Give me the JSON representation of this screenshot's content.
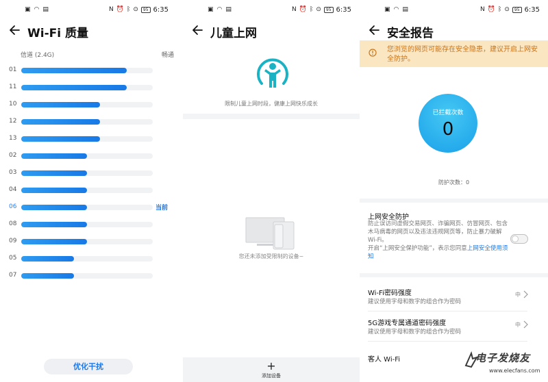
{
  "status_bar": {
    "time": "6:35",
    "battery": "95",
    "left_icons": [
      "image-icon",
      "wifi-icon",
      "gallery-icon"
    ],
    "right_icons": [
      "nfc-icon",
      "alarm-icon",
      "bluetooth-icon",
      "location-icon"
    ]
  },
  "panel1": {
    "title": "Wi-Fi 质量",
    "channel_header": "信道 (2.4G)",
    "status_header": "畅通",
    "channels": [
      {
        "num": "01",
        "level": 0.8,
        "current": false
      },
      {
        "num": "11",
        "level": 0.8,
        "current": false
      },
      {
        "num": "10",
        "level": 0.6,
        "current": false
      },
      {
        "num": "12",
        "level": 0.6,
        "current": false
      },
      {
        "num": "13",
        "level": 0.6,
        "current": false
      },
      {
        "num": "02",
        "level": 0.5,
        "current": false
      },
      {
        "num": "03",
        "level": 0.5,
        "current": false
      },
      {
        "num": "04",
        "level": 0.5,
        "current": false
      },
      {
        "num": "06",
        "level": 0.5,
        "current": true
      },
      {
        "num": "08",
        "level": 0.5,
        "current": false
      },
      {
        "num": "09",
        "level": 0.5,
        "current": false
      },
      {
        "num": "05",
        "level": 0.4,
        "current": false
      },
      {
        "num": "07",
        "level": 0.4,
        "current": false
      }
    ],
    "current_label": "当前",
    "optimize_button": "优化干扰",
    "accent": "#1e78e6"
  },
  "panel2": {
    "title": "儿童上网",
    "description": "限制儿童上网时段，健康上网快乐成长",
    "empty_text": "您还未添加受限制的设备~",
    "add_label": "添加设备",
    "icon_color": "#1bb3c4"
  },
  "panel3": {
    "title": "安全报告",
    "warning": "您浏览的网页可能存在安全隐患，建议开启上网安全防护。",
    "blocked_label": "已拦截次数",
    "blocked_count": "0",
    "protect_count": "防护次数：0",
    "protection": {
      "title": "上网安全防护",
      "desc": "防止误访问虚假交易网页、诈骗网页、仿冒网页、包含木马病毒的网页以及违法违规网页等，防止暴力破解 Wi-Fi。",
      "notice_prefix": "开启“上网安全保护功能”，表示您同意",
      "notice_link": "上网安全使用须知",
      "enabled": false
    },
    "items": [
      {
        "title": "Wi-Fi密码强度",
        "sub": "建议使用字母和数字的组合作为密码",
        "value": "中"
      },
      {
        "title": "5G游戏专属通道密码强度",
        "sub": "建议使用字母和数字的组合作为密码",
        "value": "中"
      },
      {
        "title": "客人 Wi-Fi",
        "sub": "",
        "value": ""
      }
    ],
    "warning_bg": "#fbe6c2",
    "warning_color": "#c9751a"
  },
  "watermark": {
    "brand": "电子发烧友",
    "url": "www.elecfans.com"
  }
}
